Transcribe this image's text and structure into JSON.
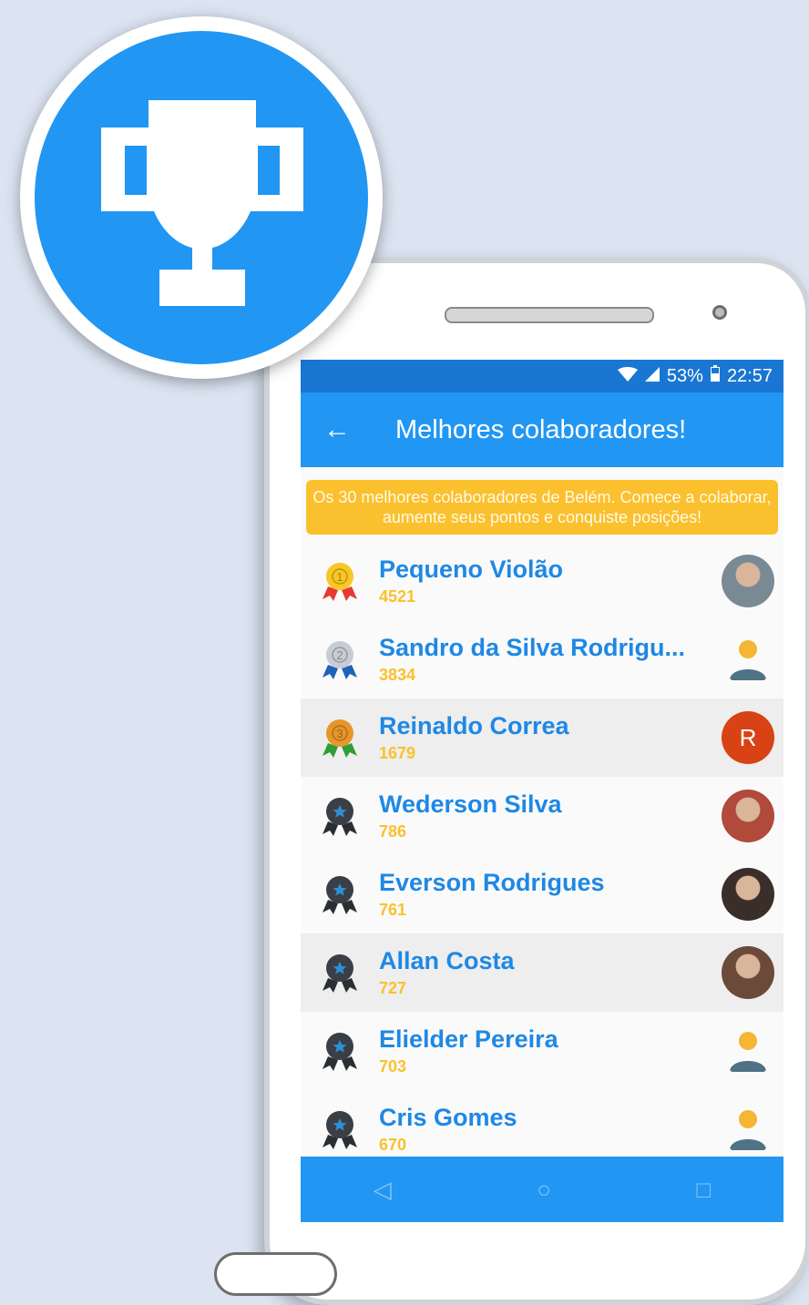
{
  "status": {
    "battery": "53%",
    "time": "22:57"
  },
  "appbar": {
    "back_icon": "arrow-left-icon",
    "title": "Melhores colaboradores!"
  },
  "banner": {
    "text": "Os 30 melhores colaboradores de Belém. Comece a colaborar, aumente seus pontos e conquiste posições!"
  },
  "colors": {
    "primary": "#2196f3",
    "primary_dark": "#1976d2",
    "accent": "#fbc02d",
    "name": "#1e88e5"
  },
  "rows": [
    {
      "name": "Pequeno Violão",
      "points": "4521",
      "medal": "gold",
      "rank": "1",
      "avatar": "photo"
    },
    {
      "name": "Sandro da Silva Rodrigu...",
      "points": "3834",
      "medal": "silver",
      "rank": "2",
      "avatar": "placeholder"
    },
    {
      "name": "Reinaldo Correa",
      "points": "1679",
      "medal": "bronze",
      "rank": "3",
      "avatar": "letter",
      "letter": "R"
    },
    {
      "name": "Wederson Silva",
      "points": "786",
      "medal": "star",
      "avatar": "photo"
    },
    {
      "name": "Everson Rodrigues",
      "points": "761",
      "medal": "star",
      "avatar": "photo"
    },
    {
      "name": "Allan Costa",
      "points": "727",
      "medal": "star",
      "avatar": "photo"
    },
    {
      "name": "Elielder Pereira",
      "points": "703",
      "medal": "star",
      "avatar": "placeholder"
    },
    {
      "name": "Cris Gomes",
      "points": "670",
      "medal": "star",
      "avatar": "placeholder"
    }
  ],
  "navbar": {
    "back": "◁",
    "home": "○",
    "recents": "□"
  }
}
